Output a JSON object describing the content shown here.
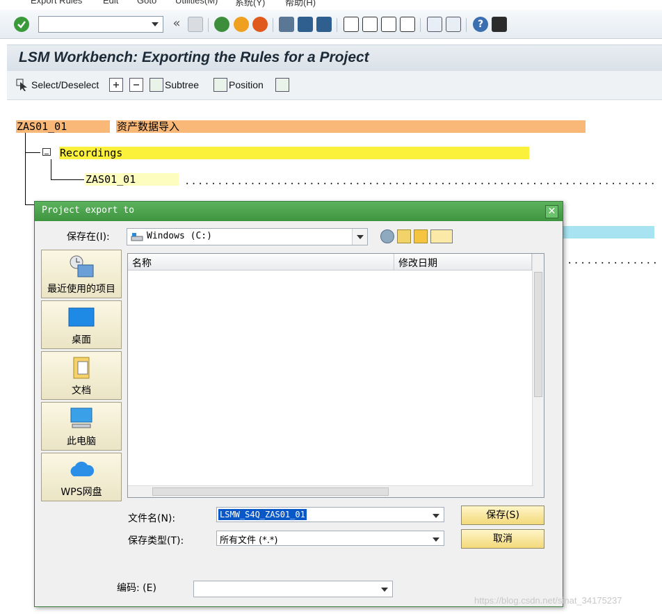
{
  "menu": [
    "Export Rules",
    "Edit",
    "Goto",
    "Utilities(M)",
    "系统(Y)",
    "帮助(H)"
  ],
  "title": "LSM Workbench: Exporting the Rules for a Project",
  "app_toolbar": {
    "select_deselect": "Select/Deselect",
    "subtree": "Subtree",
    "position": "Position"
  },
  "tree": {
    "project_id": "ZAS01_01",
    "project_desc": "资产数据导入",
    "recordings_label": "Recordings",
    "recording_id": "ZAS01_01"
  },
  "colors": {
    "project_row": "#f9b878",
    "recordings_row": "#fbf03a",
    "recording_row": "#fdfdc0",
    "hidden_row": "#a7e3f1",
    "dialog_title": "#4aa34a",
    "button": "#f6dc84"
  },
  "dialog": {
    "title": "Project export to",
    "save_in_label": "保存在(I):",
    "save_in_value": "Windows (C:)",
    "places": [
      {
        "label": "最近使用的项目",
        "icon": "recent-items-icon"
      },
      {
        "label": "桌面",
        "icon": "desktop-icon"
      },
      {
        "label": "文档",
        "icon": "documents-icon"
      },
      {
        "label": "此电脑",
        "icon": "this-pc-icon"
      },
      {
        "label": "WPS网盘",
        "icon": "wps-cloud-icon"
      }
    ],
    "columns": [
      "名称",
      "修改日期"
    ],
    "filename_label": "文件名(N):",
    "filename_value": "LSMW_S4Q_ZAS01_01",
    "filetype_label": "保存类型(T):",
    "filetype_value": "所有文件 (*.*)",
    "save_button": "保存(S)",
    "cancel_button": "取消",
    "encoding_label": "编码: (E)"
  },
  "watermark": "https://blog.csdn.net/sinat_34175237"
}
